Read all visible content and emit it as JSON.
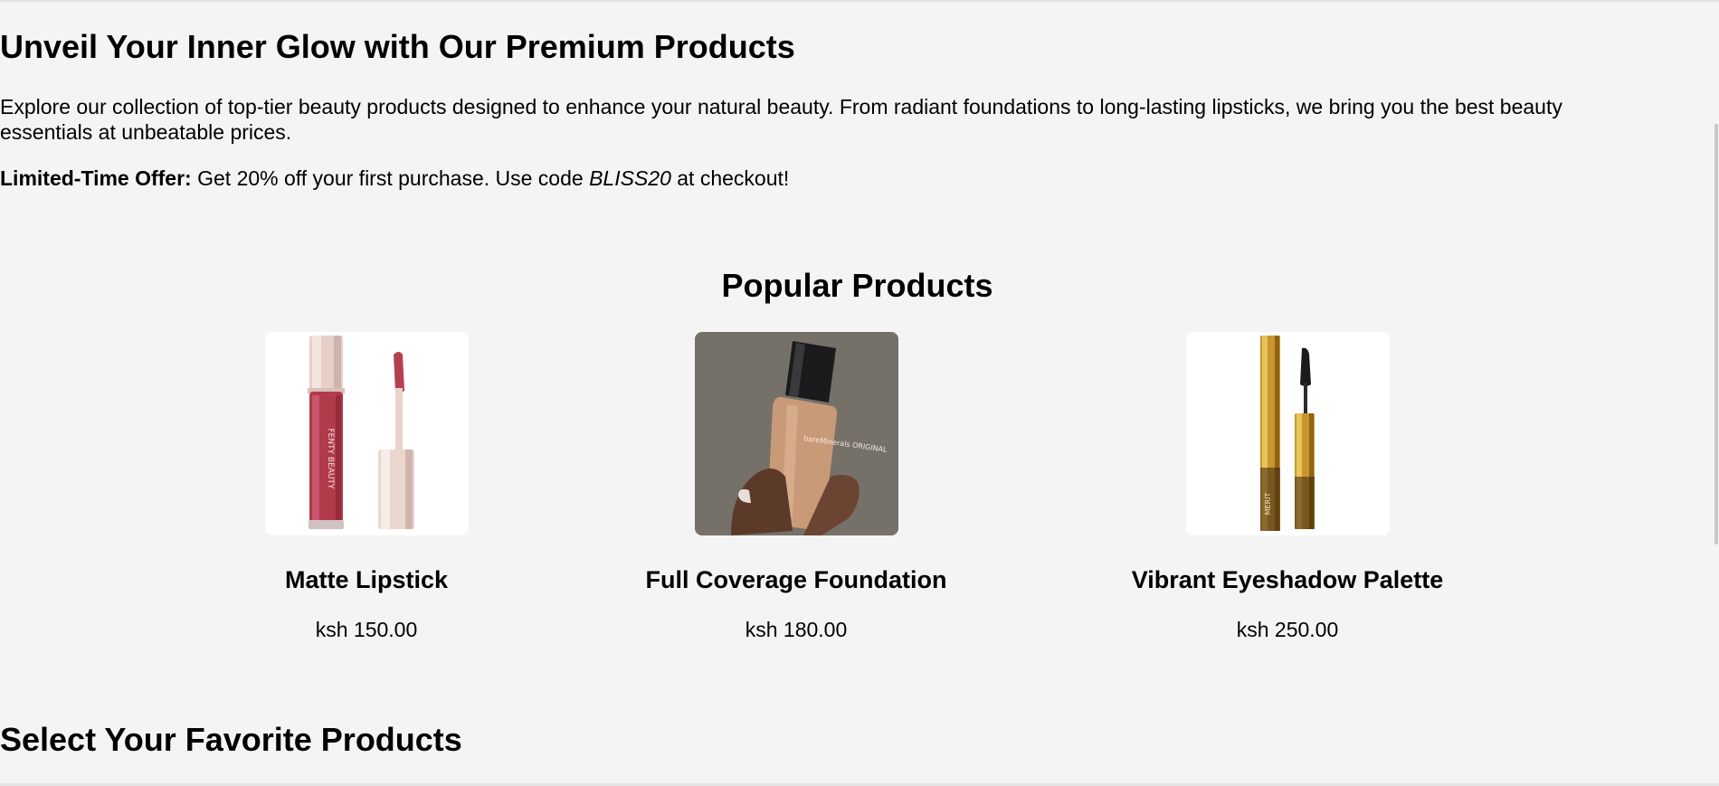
{
  "hero": {
    "title": "Unveil Your Inner Glow with Our Premium Products",
    "description": "Explore our collection of top-tier beauty products designed to enhance your natural beauty. From radiant foundations to long-lasting lipsticks, we bring you the best beauty essentials at unbeatable prices.",
    "offer_label": "Limited-Time Offer:",
    "offer_text_before": " Get 20% off your first purchase. Use code ",
    "offer_code": "BLISS20",
    "offer_text_after": " at checkout!"
  },
  "popular": {
    "title": "Popular Products",
    "products": [
      {
        "name": "Matte Lipstick",
        "price": "ksh 150.00",
        "image_icon": "lip-gloss-image",
        "brand_text": "FENTY BEAUTY"
      },
      {
        "name": "Full Coverage Foundation",
        "price": "ksh 180.00",
        "image_icon": "foundation-bottle-image",
        "brand_text": "bareMinerals ORIGINAL"
      },
      {
        "name": "Vibrant Eyeshadow Palette",
        "price": "ksh 250.00",
        "image_icon": "mascara-image",
        "brand_text": "MERIT"
      }
    ]
  },
  "select": {
    "title": "Select Your Favorite Products"
  },
  "colors": {
    "background": "#f4f4f4",
    "text": "#000000",
    "card_background": "#ffffff"
  }
}
